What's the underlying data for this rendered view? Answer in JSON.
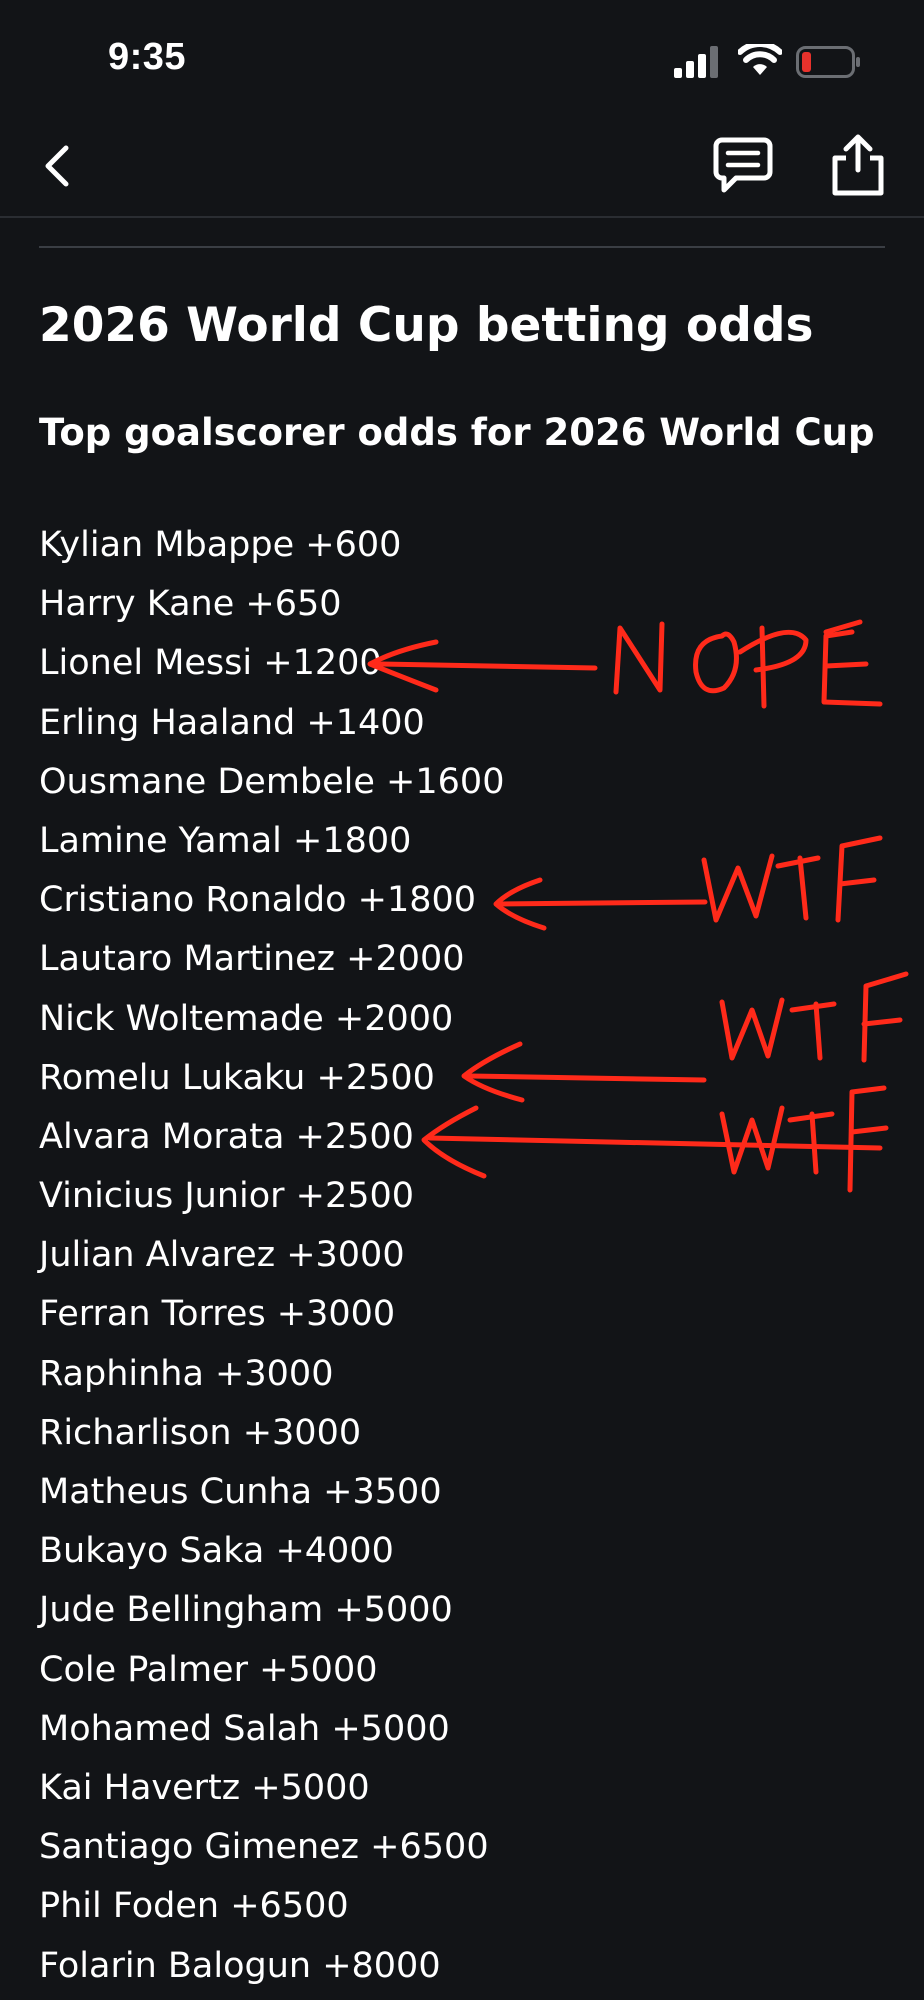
{
  "status_bar": {
    "time": "9:35",
    "icons": [
      "signal-icon",
      "wifi-icon",
      "battery-low-icon"
    ],
    "battery_color": "#e8322c"
  },
  "nav": {
    "icons": [
      "back-chevron-icon",
      "comments-icon",
      "share-icon"
    ]
  },
  "article": {
    "title": "2026 World Cup betting odds",
    "subtitle": "Top goalscorer odds for 2026 World Cup",
    "odds": [
      "Kylian Mbappe +600",
      "Harry Kane +650",
      "Lionel Messi +1200",
      "Erling Haaland +1400",
      "Ousmane Dembele +1600",
      "Lamine Yamal +1800",
      "Cristiano Ronaldo +1800",
      "Lautaro Martinez +2000",
      "Nick Woltemade +2000",
      "Romelu Lukaku +2500",
      "Alvara Morata +2500",
      "Vinicius Junior +2500",
      "Julian Alvarez +3000",
      "Ferran Torres +3000",
      "Raphinha +3000",
      "Richarlison +3000",
      "Matheus Cunha +3500",
      "Bukayo Saka +4000",
      "Jude Bellingham +5000",
      "Cole Palmer +5000",
      "Mohamed Salah +5000",
      "Kai Havertz +5000",
      "Santiago Gimenez +6500",
      "Phil Foden +6500",
      "Folarin Balogun +8000"
    ]
  },
  "annotations": {
    "color": "#ff2a1a",
    "notes": [
      "NOPE",
      "WTF",
      "WTF",
      "WTF"
    ]
  }
}
